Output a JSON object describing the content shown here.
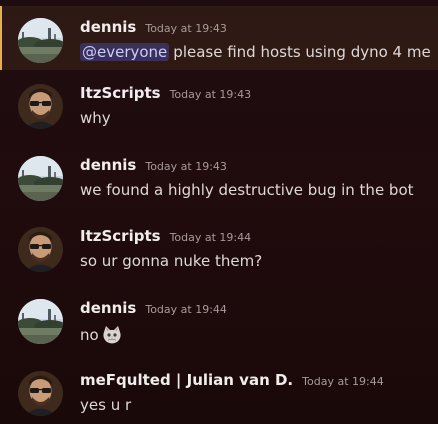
{
  "messages": [
    {
      "username": "dennis",
      "timestamp": "Today at 19:43",
      "mention": "@everyone",
      "text": "please find hosts using dyno 4 me",
      "avatar": "landscape",
      "highlighted": true
    },
    {
      "username": "ItzScripts",
      "timestamp": "Today at 19:43",
      "text": "why",
      "avatar": "person"
    },
    {
      "username": "dennis",
      "timestamp": "Today at 19:43",
      "text": "we found a highly destructive bug in the bot",
      "avatar": "landscape"
    },
    {
      "username": "ItzScripts",
      "timestamp": "Today at 19:44",
      "text": "so ur gonna nuke them?",
      "avatar": "person"
    },
    {
      "username": "dennis",
      "timestamp": "Today at 19:44",
      "text": "no",
      "emoji": "cat-emoji",
      "avatar": "landscape"
    },
    {
      "username": "meFqulted | Julian van D.",
      "timestamp": "Today at 19:44",
      "text": "yes u r",
      "avatar": "person"
    }
  ],
  "colors": {
    "background": "#200b0d",
    "mention_bar": "#e8b04a",
    "mention_chip": "#5865f2"
  }
}
